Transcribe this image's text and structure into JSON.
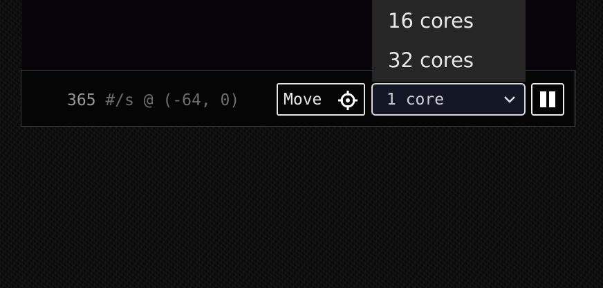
{
  "status": {
    "rate": "365",
    "suffix": " #/s @ (-64, 0)"
  },
  "toolbar": {
    "move_label": "Move",
    "move_icon": "crosshair-icon",
    "core_select_value": "1 core",
    "pause_icon": "pause-icon"
  },
  "dropdown": {
    "options": [
      "16 cores",
      "32 cores"
    ]
  },
  "colors": {
    "background": "#0a0a0a",
    "toolbar_bg": "#050505",
    "select_bg": "#141826",
    "dropdown_bg": "#262626",
    "text_light": "#e6e6e6",
    "text_dim": "#6e6e6e"
  }
}
